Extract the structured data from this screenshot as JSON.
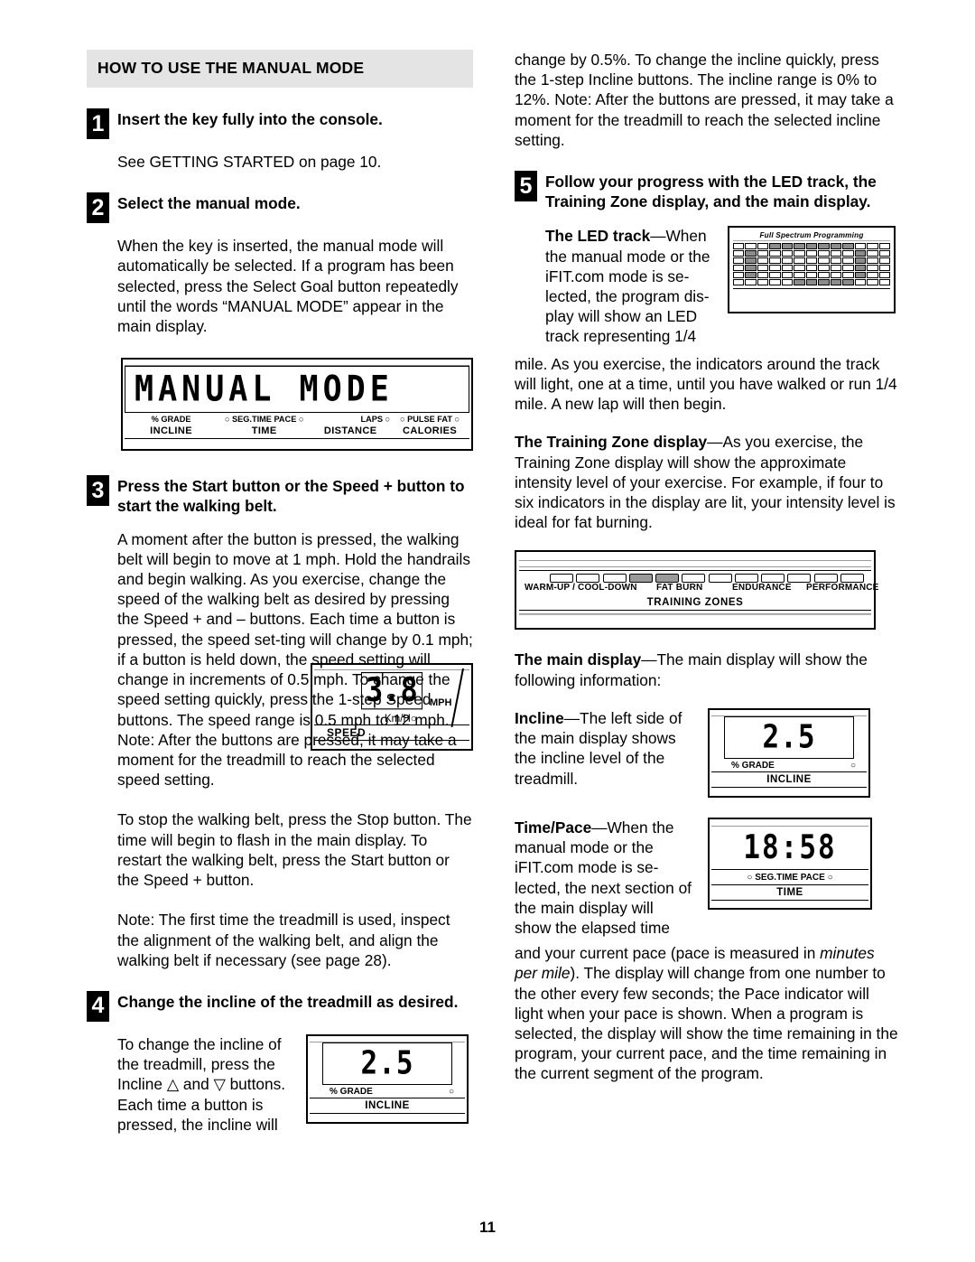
{
  "section": {
    "header": "HOW TO USE THE MANUAL MODE"
  },
  "page": {
    "number": "11"
  },
  "left_column": {
    "step1": {
      "num": "1",
      "title": "Insert the key fully into the console.",
      "body": "See GETTING STARTED on page 10."
    },
    "step2": {
      "num": "2",
      "title": "Select the manual mode.",
      "body": "When the key is inserted, the manual mode will automatically be selected. If a program has been selected, press the Select Goal button repeatedly until the words “MANUAL MODE” appear in the main display."
    },
    "manual_mode_display": {
      "lcd_text": "MANUAL MODE",
      "indicator_labels": [
        "% GRADE",
        "○ SEG.TIME PACE ○",
        "LAPS ○",
        "○ PULSE FAT ○"
      ],
      "section_labels": [
        "INCLINE",
        "TIME",
        "DISTANCE",
        "CALORIES"
      ]
    },
    "step3": {
      "num": "3",
      "title": "Press the Start button or the Speed + button to start the walking belt.",
      "body_a": "A moment after the button is pressed, the walking belt will begin to move at 1 mph. Hold the handrails and begin walking. As you exercise, change the speed of the walking belt as desired by pressing the Speed + and – buttons. Each time a button is pressed, the speed set-ting will change by 0.1 mph; if a button is held down, the speed setting will change in increments of 0.5 mph. To change the speed setting quickly, press the 1-step Speed buttons. The speed range is 0.5 mph to 12 mph. Note: After the buttons are pressed, it may take a moment for the treadmill to reach the selected speed setting.",
      "body_b": "To stop the walking belt, press the Stop button. The time will begin to flash in the main display. To restart the walking belt, press the Start button or the Speed + button.",
      "body_c": "Note: The first time the treadmill is used, inspect the alignment of the walking belt, and align the walking belt if necessary (see page 28)."
    },
    "speed_display": {
      "value": "3.8",
      "unit_mph": "MPH",
      "unit_km": "Km/H○",
      "caption": "SPEED"
    },
    "step4": {
      "num": "4",
      "title": "Change the incline of the treadmill as desired.",
      "body": "To change the incline of the treadmill, press the Incline △ and ▽ buttons. Each time a button is pressed, the incline will"
    },
    "incline_display_bottom": {
      "value": "2.5",
      "label_grade": "% GRADE",
      "label_dot": "○",
      "caption": "INCLINE"
    }
  },
  "right_column": {
    "continued": "change by 0.5%. To change the incline quickly, press the 1-step Incline buttons. The incline range is 0% to 12%. Note: After the buttons are pressed, it may take a moment for the treadmill to reach the selected incline setting.",
    "step5": {
      "num": "5",
      "title": "Follow your progress with the LED track, the Training Zone display, and the main display."
    },
    "led_track": {
      "heading": "The LED track",
      "dash": "—",
      "text_narrow": "When the manual mode or the iFIT.com mode is se-lected, the program dis-play will show an LED track representing 1/4",
      "text_full": "mile. As you exercise, the indicators around the track will light, one at a time, until you have walked or run 1/4 mile. A new lap will then begin.",
      "panel_title": "Full Spectrum Programming"
    },
    "training_zone": {
      "heading": "The Training Zone display",
      "dash": "—",
      "text": "As you exercise, the Training Zone display will show the approximate intensity level of your exercise. For example, if four to six indicators in the display are lit, your intensity level is ideal for fat burning.",
      "zone_labels": [
        "WARM-UP / COOL-DOWN",
        "FAT BURN",
        "ENDURANCE",
        "PERFORMANCE"
      ],
      "panel_caption": "TRAINING ZONES",
      "bars_total": 12,
      "bars_lit": [
        4,
        5
      ]
    },
    "main_display": {
      "heading": "The main display",
      "dash": "—",
      "text": "The main display will show the following information:"
    },
    "incline_item": {
      "heading": "Incline",
      "dash": "—",
      "text": "The left side of the main display shows the incline level of the treadmill.",
      "display": {
        "value": "2.5",
        "label_grade": "% GRADE",
        "label_dot": "○",
        "caption": "INCLINE"
      }
    },
    "time_pace_item": {
      "heading": "Time/Pace",
      "dash": "—",
      "text_narrow": "When the manual mode or the iFIT.com mode is se-lected, the next section of the main display will show the elapsed time",
      "text_full_a": "and your current pace (pace is measured in ",
      "text_italic": "minutes per mile",
      "text_full_b": "). The display will change from one number to the other every few seconds; the Pace indicator will light when your pace is shown. When a program is selected, the display will show the time remaining in the program, your current pace, and the time remaining in the current segment of the program.",
      "display": {
        "value": "18:58",
        "label_row": "○ SEG.TIME PACE ○",
        "caption": "TIME"
      }
    }
  },
  "led_pattern": [
    [
      0,
      0,
      0,
      1,
      1,
      1,
      1,
      1,
      1,
      1,
      0,
      0,
      0
    ],
    [
      0,
      1,
      0,
      0,
      0,
      0,
      0,
      0,
      0,
      0,
      1,
      0,
      0
    ],
    [
      0,
      1,
      0,
      0,
      0,
      0,
      0,
      0,
      0,
      0,
      1,
      0,
      0
    ],
    [
      0,
      1,
      0,
      0,
      0,
      0,
      0,
      0,
      0,
      0,
      1,
      0,
      0
    ],
    [
      0,
      1,
      0,
      0,
      0,
      0,
      0,
      0,
      0,
      0,
      1,
      0,
      0
    ],
    [
      0,
      0,
      0,
      0,
      0,
      1,
      1,
      1,
      1,
      1,
      0,
      0,
      0
    ]
  ]
}
